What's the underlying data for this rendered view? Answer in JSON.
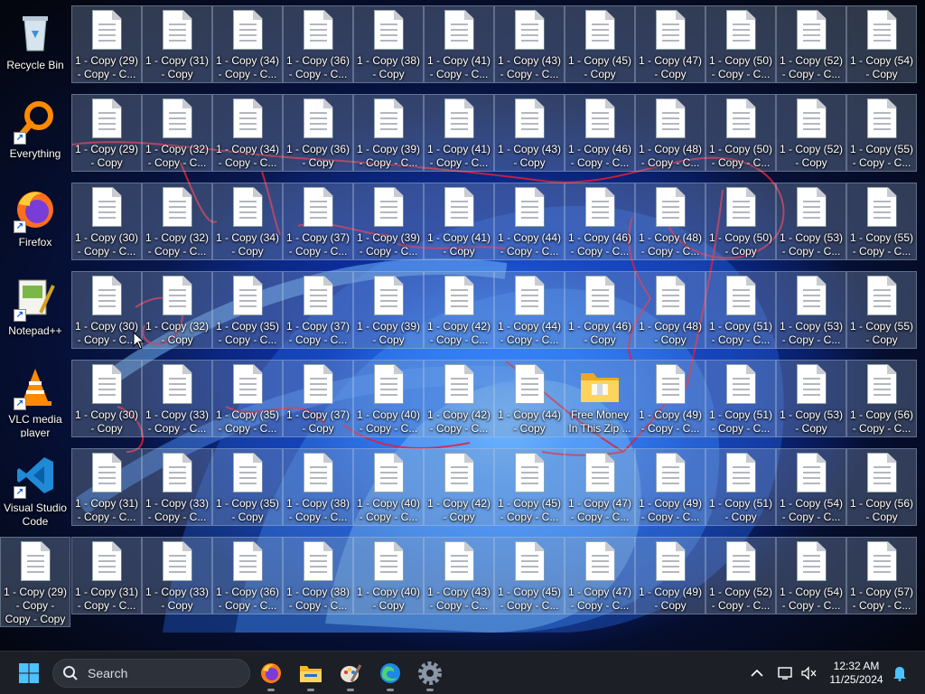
{
  "desktop": {
    "shortcuts": [
      {
        "label": "Recycle Bin",
        "icon": "recycle-bin-icon"
      },
      {
        "label": "Everything",
        "icon": "everything-magnifier-icon"
      },
      {
        "label": "Firefox",
        "icon": "firefox-icon"
      },
      {
        "label": "Notepad++",
        "icon": "notepad-plus-plus-icon"
      },
      {
        "label": "VLC media\nplayer",
        "icon": "vlc-cone-icon"
      },
      {
        "label": "Visual Studio\nCode",
        "icon": "vscode-icon"
      }
    ],
    "file_rows": [
      [
        "1 - Copy (29)\n- Copy - C...",
        "1 - Copy (31)\n- Copy",
        "1 - Copy (34)\n- Copy - C...",
        "1 - Copy (36)\n- Copy - C...",
        "1 - Copy (38)\n- Copy",
        "1 - Copy (41)\n- Copy - C...",
        "1 - Copy (43)\n- Copy - C...",
        "1 - Copy (45)\n- Copy",
        "1 - Copy (47)\n- Copy",
        "1 - Copy (50)\n- Copy - C...",
        "1 - Copy (52)\n- Copy - C...",
        "1 - Copy (54)\n- Copy"
      ],
      [
        "1 - Copy (29)\n- Copy",
        "1 - Copy (32)\n- Copy - C...",
        "1 - Copy (34)\n- Copy - C...",
        "1 - Copy (36)\n- Copy",
        "1 - Copy (39)\n- Copy - C...",
        "1 - Copy (41)\n- Copy - C...",
        "1 - Copy (43)\n- Copy",
        "1 - Copy (46)\n- Copy - C...",
        "1 - Copy (48)\n- Copy - C...",
        "1 - Copy (50)\n- Copy - C...",
        "1 - Copy (52)\n- Copy",
        "1 - Copy (55)\n- Copy - C..."
      ],
      [
        "1 - Copy (30)\n- Copy - C...",
        "1 - Copy (32)\n- Copy - C...",
        "1 - Copy (34)\n- Copy",
        "1 - Copy (37)\n- Copy - C...",
        "1 - Copy (39)\n- Copy - C...",
        "1 - Copy (41)\n- Copy",
        "1 - Copy (44)\n- Copy - C...",
        "1 - Copy (46)\n- Copy - C...",
        "1 - Copy (48)\n- Copy - C...",
        "1 - Copy (50)\n- Copy",
        "1 - Copy (53)\n- Copy - C...",
        "1 - Copy (55)\n- Copy - C..."
      ],
      [
        "1 - Copy (30)\n- Copy - C...",
        "1 - Copy (32)\n- Copy",
        "1 - Copy (35)\n- Copy - C...",
        "1 - Copy (37)\n- Copy - C...",
        "1 - Copy (39)\n- Copy",
        "1 - Copy (42)\n- Copy - C...",
        "1 - Copy (44)\n- Copy - C...",
        "1 - Copy (46)\n- Copy",
        "1 - Copy (48)\n- Copy",
        "1 - Copy (51)\n- Copy - C...",
        "1 - Copy (53)\n- Copy - C...",
        "1 - Copy (55)\n- Copy"
      ],
      [
        "1 - Copy (30)\n- Copy",
        "1 - Copy (33)\n- Copy - C...",
        "1 - Copy (35)\n- Copy - C...",
        "1 - Copy (37)\n- Copy",
        "1 - Copy (40)\n- Copy - C...",
        "1 - Copy (42)\n- Copy - C...",
        "1 - Copy (44)\n- Copy",
        "FOLDER",
        "1 - Copy (49)\n- Copy - C...",
        "1 - Copy (51)\n- Copy - C...",
        "1 - Copy (53)\n- Copy",
        "1 - Copy (56)\n- Copy - C..."
      ],
      [
        "1 - Copy (31)\n- Copy - C...",
        "1 - Copy (33)\n- Copy - C...",
        "1 - Copy (35)\n- Copy",
        "1 - Copy (38)\n- Copy - C...",
        "1 - Copy (40)\n- Copy - C...",
        "1 - Copy (42)\n- Copy",
        "1 - Copy (45)\n- Copy - C...",
        "1 - Copy (47)\n- Copy - C...",
        "1 - Copy (49)\n- Copy - C...",
        "1 - Copy (51)\n- Copy",
        "1 - Copy (54)\n- Copy - C...",
        "1 - Copy (56)\n- Copy"
      ],
      [
        "1 - Copy (31)\n- Copy - C...",
        "1 - Copy (33)\n- Copy",
        "1 - Copy (36)\n- Copy - C...",
        "1 - Copy (38)\n- Copy - C...",
        "1 - Copy (40)\n- Copy",
        "1 - Copy (43)\n- Copy - C...",
        "1 - Copy (45)\n- Copy - C...",
        "1 - Copy (47)\n- Copy - C...",
        "1 - Copy (49)\n- Copy",
        "1 - Copy (52)\n- Copy - C...",
        "1 - Copy (54)\n- Copy - C...",
        "1 - Copy (57)\n- Copy - C..."
      ]
    ],
    "bottom_left_file": "1 - Copy (29)\n- Copy -\nCopy - Copy",
    "folder": {
      "label": "Free Money\nIn This Zip ...",
      "icon": "zip-folder-icon"
    }
  },
  "taskbar": {
    "start_icon": "windows-start-icon",
    "search_placeholder": "Search",
    "apps": [
      {
        "name": "Firefox",
        "icon": "firefox-icon"
      },
      {
        "name": "File Explorer",
        "icon": "file-explorer-icon"
      },
      {
        "name": "Paint",
        "icon": "paint-icon"
      },
      {
        "name": "Microsoft Edge",
        "icon": "edge-icon"
      },
      {
        "name": "Settings",
        "icon": "settings-gear-icon"
      }
    ],
    "tray": {
      "chevron_icon": "chevron-up-icon",
      "network_icon": "network-icon",
      "volume_icon": "volume-muted-icon",
      "time": "12:32 AM",
      "date": "11/25/2024",
      "notification_icon": "notification-bell-icon"
    }
  },
  "colors": {
    "taskbar_bg": "#1c1f26",
    "selection_bg": "#8ca0be",
    "annotation_red": "#e0203a",
    "windows_blue": "#4cc2ff"
  }
}
